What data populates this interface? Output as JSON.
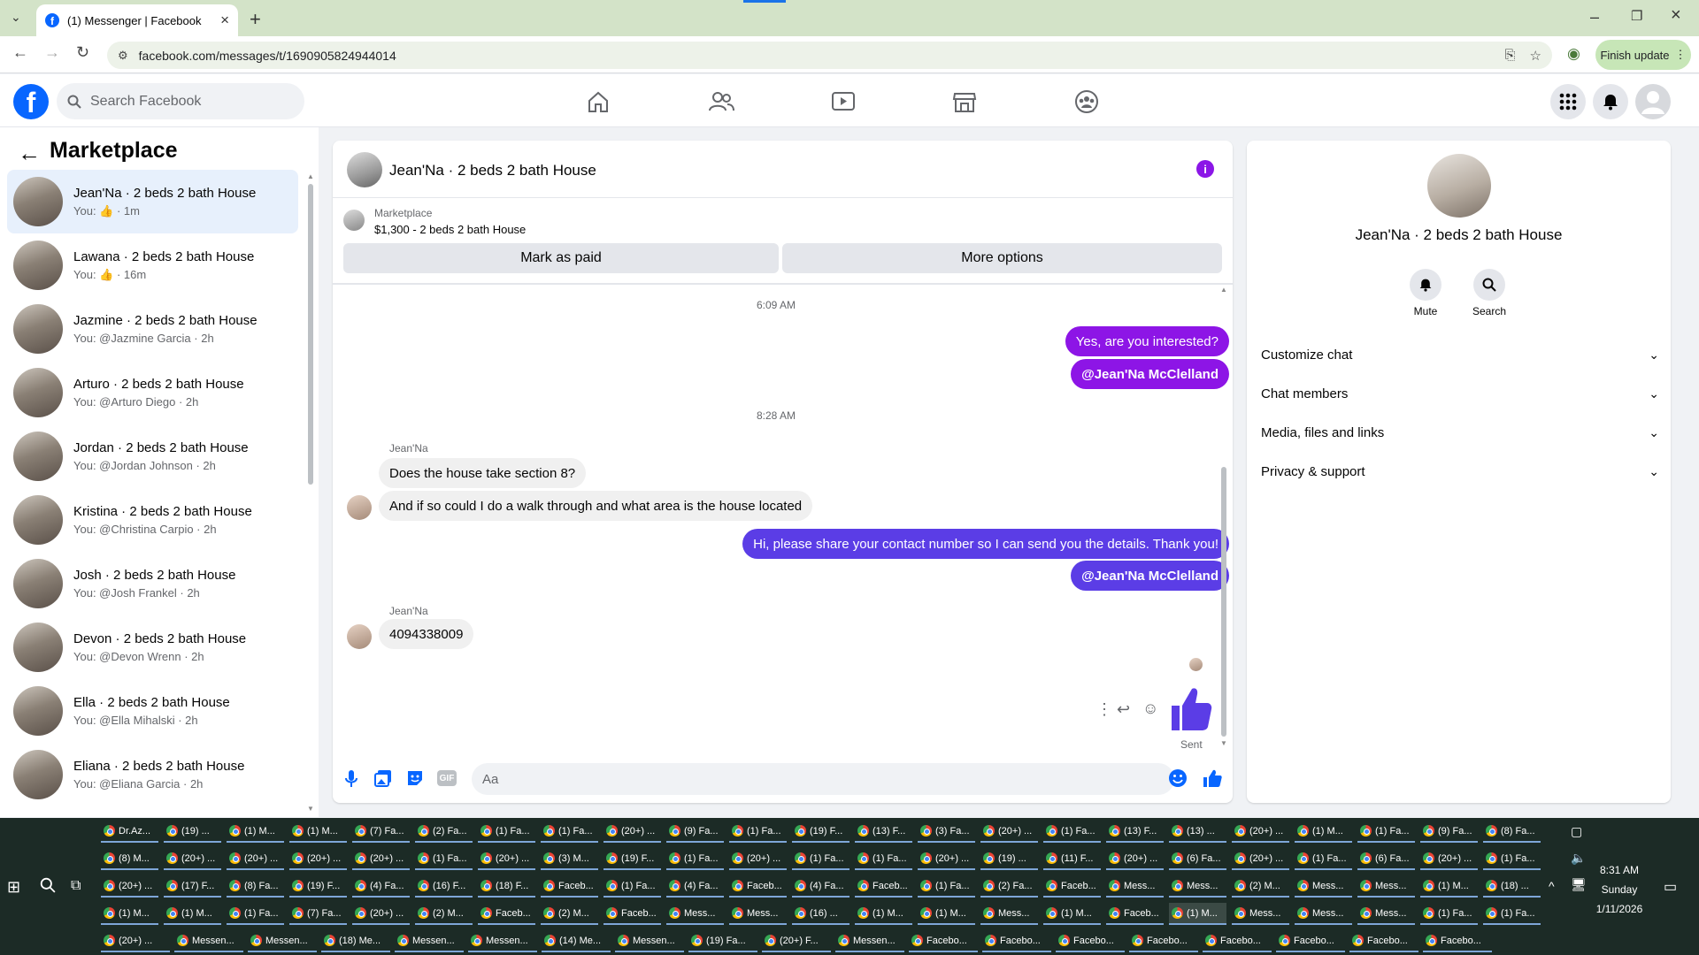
{
  "browser": {
    "tab_title": "(1) Messenger | Facebook",
    "url": "facebook.com/messages/t/1690905824944014",
    "finish_update": "Finish update"
  },
  "fb": {
    "search_placeholder": "Search Facebook"
  },
  "left": {
    "title": "Marketplace",
    "conversations": [
      {
        "name": "Jean'Na · 2 beds 2 bath House",
        "sub": "You: 👍 · 1m",
        "active": true
      },
      {
        "name": "Lawana · 2 beds 2 bath House",
        "sub": "You: 👍 · 16m"
      },
      {
        "name": "Jazmine · 2 beds 2 bath House",
        "sub": "You: @Jazmine Garcia · 2h"
      },
      {
        "name": "Arturo · 2 beds 2 bath House",
        "sub": "You: @Arturo Diego · 2h"
      },
      {
        "name": "Jordan · 2 beds 2 bath House",
        "sub": "You: @Jordan Johnson · 2h"
      },
      {
        "name": "Kristina · 2 beds 2 bath House",
        "sub": "You: @Christina Carpio · 2h"
      },
      {
        "name": "Josh · 2 beds 2 bath House",
        "sub": "You: @Josh Frankel · 2h"
      },
      {
        "name": "Devon · 2 beds 2 bath House",
        "sub": "You: @Devon Wrenn · 2h"
      },
      {
        "name": "Ella · 2 beds 2 bath House",
        "sub": "You: @Ella Mihalski · 2h"
      },
      {
        "name": "Eliana · 2 beds 2 bath House",
        "sub": "You: @Eliana Garcia · 2h"
      }
    ]
  },
  "chat": {
    "title": "Jean'Na · 2 beds 2 bath House",
    "marketplace_label": "Marketplace",
    "listing": "$1,300 - 2 beds 2 bath House",
    "mark_paid": "Mark as paid",
    "more_options": "More options",
    "time1": "6:09 AM",
    "msg_out1": "Yes, are you interested?",
    "mention1": "@Jean'Na McClelland",
    "time2": "8:28 AM",
    "sender1": "Jean'Na",
    "msg_in1": "Does the house take section 8?",
    "msg_in2": "And if so could I do a walk through and what area is the house located",
    "msg_out2": "Hi, please share your contact number so I can send you the details. Thank you!",
    "mention2": "@Jean'Na McClelland",
    "sender2": "Jean'Na",
    "msg_in3": "4094338009",
    "sent_label": "Sent",
    "input_placeholder": "Aa"
  },
  "right": {
    "name": "Jean'Na · 2 beds 2 bath House",
    "mute": "Mute",
    "search": "Search",
    "sections": [
      "Customize chat",
      "Chat members",
      "Media, files and links",
      "Privacy & support"
    ]
  },
  "taskbar": {
    "rows": [
      [
        "Dr.Az...",
        "(19) ...",
        "(1) M...",
        "(1) M...",
        "(7) Fa...",
        "(2) Fa...",
        "(1) Fa...",
        "(1) Fa...",
        "(20+) ...",
        "(9) Fa...",
        "(1) Fa...",
        "(19) F...",
        "(13) F...",
        "(3) Fa...",
        "(20+) ...",
        "(1) Fa...",
        "(13) F...",
        "(13) ...",
        "(20+) ...",
        "(1) M...",
        "(1) Fa...",
        "(9) Fa...",
        "(8) Fa..."
      ],
      [
        "(8) M...",
        "(20+) ...",
        "(20+) ...",
        "(20+) ...",
        "(20+) ...",
        "(1) Fa...",
        "(20+) ...",
        "(3) M...",
        "(19) F...",
        "(1) Fa...",
        "(20+) ...",
        "(1) Fa...",
        "(1) Fa...",
        "(20+) ...",
        "(19) ...",
        "(11) F...",
        "(20+) ...",
        "(6) Fa...",
        "(20+) ...",
        "(1) Fa...",
        "(6) Fa...",
        "(20+) ...",
        "(1) Fa..."
      ],
      [
        "(20+) ...",
        "(17) F...",
        "(8) Fa...",
        "(19) F...",
        "(4) Fa...",
        "(16) F...",
        "(18) F...",
        "Faceb...",
        "(1) Fa...",
        "(4) Fa...",
        "Faceb...",
        "(4) Fa...",
        "Faceb...",
        "(1) Fa...",
        "(2) Fa...",
        "Faceb...",
        "Mess...",
        "Mess...",
        "(2) M...",
        "Mess...",
        "Mess...",
        "(1) M...",
        "(18) ..."
      ],
      [
        "(1) M...",
        "(1) M...",
        "(1) Fa...",
        "(7) Fa...",
        "(20+) ...",
        "(2) M...",
        "Faceb...",
        "(2) M...",
        "Faceb...",
        "Mess...",
        "Mess...",
        "(16) ...",
        "(1) M...",
        "(1) M...",
        "Mess...",
        "(1) M...",
        "Faceb...",
        "(1) M...",
        "Mess...",
        "Mess...",
        "Mess...",
        "(1) Fa...",
        "(1) Fa..."
      ],
      [
        "(20+) ...",
        "Messen...",
        "Messen...",
        "(18) Me...",
        "Messen...",
        "Messen...",
        "(14) Me...",
        "Messen...",
        "(19) Fa...",
        "(20+) F...",
        "Messen...",
        "Facebo...",
        "Facebo...",
        "Facebo...",
        "Facebo...",
        "Facebo...",
        "Facebo...",
        "Facebo...",
        "Facebo..."
      ]
    ],
    "time": "8:31 AM",
    "day": "Sunday",
    "date": "1/11/2026"
  }
}
